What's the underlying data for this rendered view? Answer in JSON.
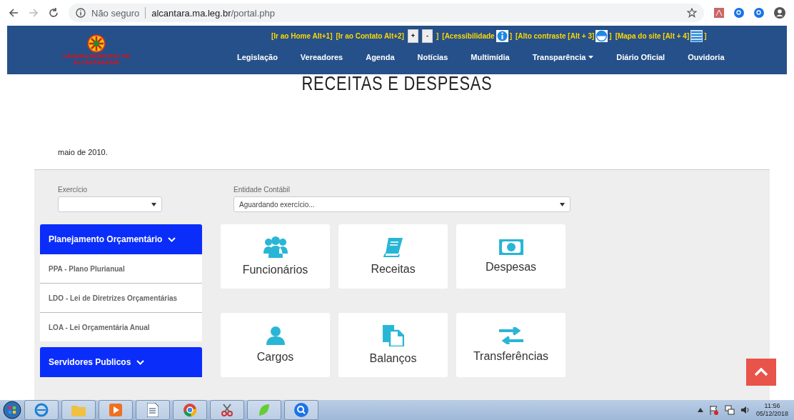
{
  "browser": {
    "security": "Não seguro",
    "url_host": "alcantara.ma.leg.br",
    "url_path": "/portal.php"
  },
  "header": {
    "logo_lines": [
      "CÂMARA MUNICIPAL DE",
      "ALCANTARA/MA"
    ],
    "accessibility": [
      {
        "kind": "link",
        "text": "[Ir ao Home Alt+1]"
      },
      {
        "kind": "link",
        "text": "[Ir ao Contato Alt+2]"
      },
      {
        "kind": "button",
        "text": "+"
      },
      {
        "kind": "button",
        "text": "-"
      },
      {
        "kind": "plain",
        "text": "]"
      },
      {
        "kind": "icon-link",
        "text": "[Acessibilidade",
        "close": "]"
      },
      {
        "kind": "icon-link",
        "text": "[Alto contraste [Alt + 3]",
        "close": "]"
      },
      {
        "kind": "icon-link",
        "text": "[Mapa do site [Alt + 4]",
        "close": "]"
      }
    ],
    "nav": [
      {
        "label": "Legislação",
        "dropdown": false
      },
      {
        "label": "Vereadores",
        "dropdown": false
      },
      {
        "label": "Agenda",
        "dropdown": false
      },
      {
        "label": "Notícias",
        "dropdown": false
      },
      {
        "label": "Multimídia",
        "dropdown": false
      },
      {
        "label": "Transparência",
        "dropdown": true
      },
      {
        "label": "Diário Oficial",
        "dropdown": false
      },
      {
        "label": "Ouvidoria",
        "dropdown": false
      }
    ]
  },
  "page_title": "RECEITAS E DESPESAS",
  "intro": "maio de 2010.",
  "filters": [
    {
      "label": "Exercício"
    },
    {
      "label": "Entidade Contábil",
      "value": "Aguardando exercício..."
    }
  ],
  "sidebar": [
    {
      "title": "Planejamento Orçamentário",
      "items": [
        "PPA - Plano Plurianual",
        "LDO - Lei de Diretrizes Orçamentárias",
        "LOA - Lei Orçamentária Anual"
      ]
    },
    {
      "title": "Servidores Publicos"
    }
  ],
  "tiles": [
    {
      "label": "Funcionários",
      "kind": "users"
    },
    {
      "label": "Receitas",
      "kind": "book"
    },
    {
      "label": "Despesas",
      "kind": "money"
    },
    {
      "label": "Cargos",
      "kind": "user"
    },
    {
      "label": "Balanços",
      "kind": "files"
    },
    {
      "label": "Transferências",
      "kind": "exchange"
    }
  ],
  "taskbar": {
    "time": "11:56",
    "date": "05/12/2018"
  }
}
